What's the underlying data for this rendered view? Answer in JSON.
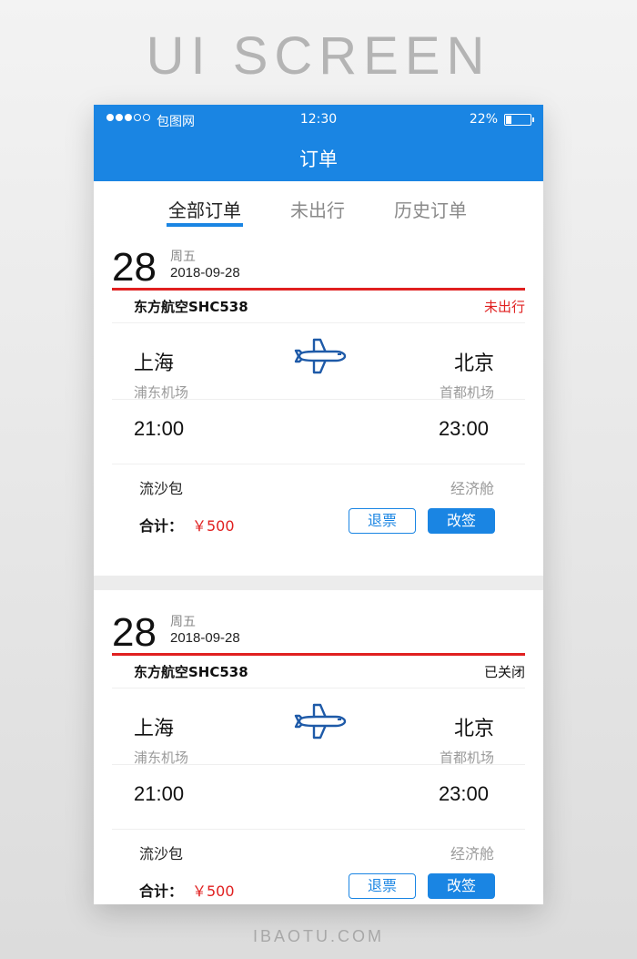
{
  "page": {
    "heading": "UI SCREEN",
    "footer": "IBAOTU.COM"
  },
  "status_bar": {
    "carrier": "包图网",
    "time": "12:30",
    "battery_percent": "22%",
    "battery_level": 0.22
  },
  "nav": {
    "title": "订单"
  },
  "tabs": [
    {
      "label": "全部订单",
      "active": true
    },
    {
      "label": "未出行",
      "active": false
    },
    {
      "label": "历史订单",
      "active": false
    }
  ],
  "orders": [
    {
      "day": "28",
      "weekday": "周五",
      "date": "2018-09-28",
      "flight": "东方航空SHC538",
      "status": "未出行",
      "from_city": "上海",
      "from_airport": "浦东机场",
      "depart_time": "21:00",
      "to_city": "北京",
      "to_airport": "首都机场",
      "arrive_time": "23:00",
      "passenger": "流沙包",
      "cabin": "经济舱",
      "total_label": "合计：",
      "total_value": "￥500",
      "refund_label": "退票",
      "change_label": "改签"
    },
    {
      "day": "28",
      "weekday": "周五",
      "date": "2018-09-28",
      "flight": "东方航空SHC538",
      "status": "已关闭",
      "from_city": "上海",
      "from_airport": "浦东机场",
      "depart_time": "21:00",
      "to_city": "北京",
      "to_airport": "首都机场",
      "arrive_time": "23:00",
      "passenger": "流沙包",
      "cabin": "经济舱",
      "total_label": "合计：",
      "total_value": "￥500",
      "refund_label": "退票",
      "change_label": "改签"
    }
  ],
  "colors": {
    "primary": "#1a85e3",
    "accent_red": "#e02020"
  },
  "icons": {
    "plane": "airplane-icon",
    "battery": "battery-icon",
    "signal": "signal-dots-icon"
  }
}
